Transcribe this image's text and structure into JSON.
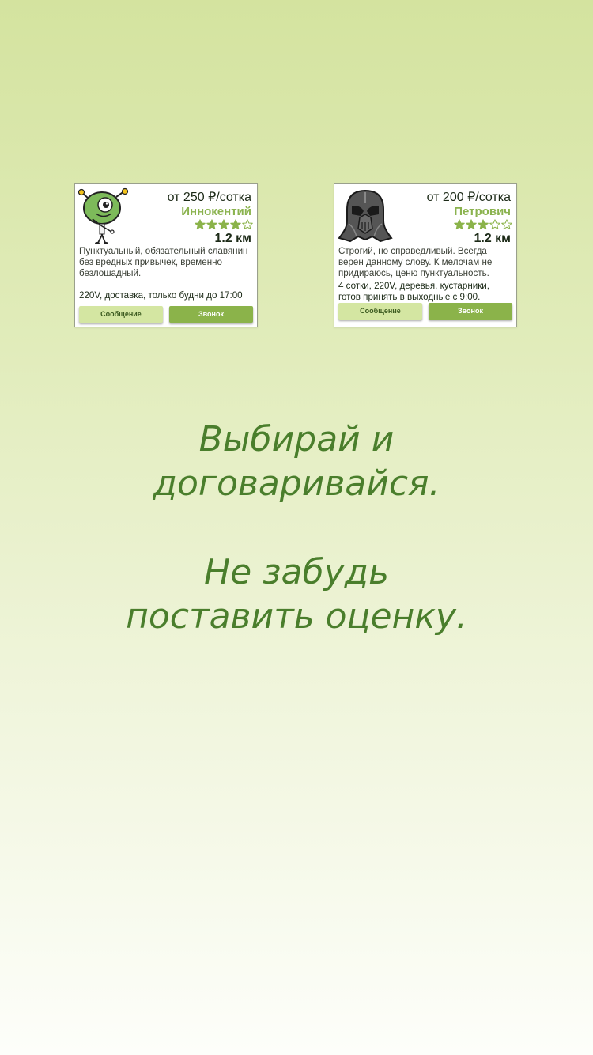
{
  "cards": [
    {
      "avatar": "green-alien-icon",
      "price": "от 250 ₽/сотка",
      "name": "Иннокентий",
      "rating": 4,
      "rating_max": 5,
      "distance": "1.2 км",
      "description": "Пунктуальный, обязательный славянин без вредных привычек, временно безлошадный.",
      "extra": "220V, доставка, только будни до 17:00",
      "message_label": "Сообщение",
      "call_label": "Звонок"
    },
    {
      "avatar": "darth-vader-helmet-icon",
      "price": "от 200 ₽/сотка",
      "name": "Петрович",
      "rating": 3,
      "rating_max": 5,
      "distance": "1.2 км",
      "description": "Строгий, но справедливый. Всегда верен данному слову. К мелочам не придираюсь, ценю пунктуальность.",
      "extra": "4 сотки, 220V, деревья, кустарники, готов принять в выходные с 9:00.",
      "message_label": "Сообщение",
      "call_label": "Звонок"
    }
  ],
  "slogan": {
    "line1": "Выбирай и",
    "line2": "договаривайся.",
    "line3": "Не забудь",
    "line4": "поставить оценку."
  },
  "colors": {
    "accent": "#8bb34a",
    "accent_light": "#d4e6a2",
    "name": "#8bb34f",
    "slogan": "#4a7e2c",
    "star": "#8bb34a"
  }
}
